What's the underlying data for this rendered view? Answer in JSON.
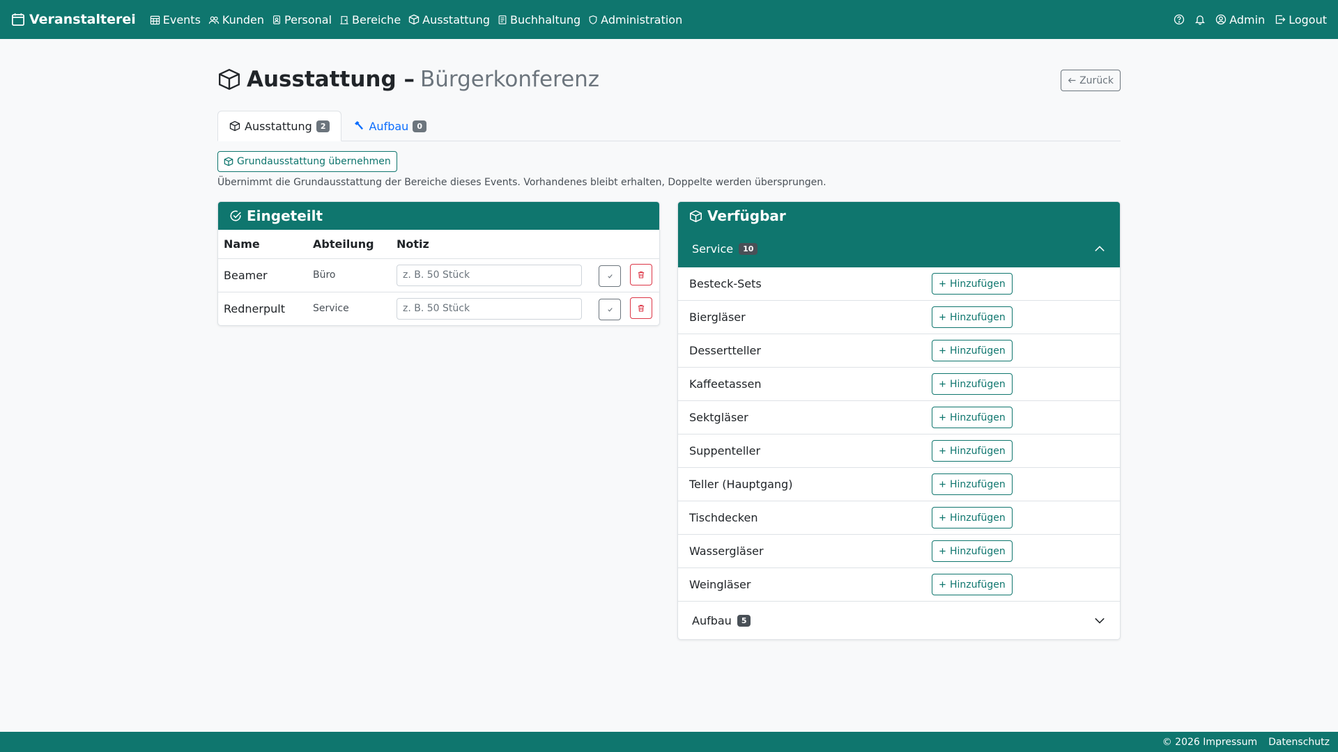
{
  "colors": {
    "brand": "#0f766e",
    "danger": "#dc3545",
    "link": "#0d6efd",
    "muted": "#6c757d"
  },
  "navbar": {
    "brand": "Veranstalterei",
    "items": [
      {
        "label": "Events",
        "icon": "calendar-grid-icon"
      },
      {
        "label": "Kunden",
        "icon": "people-icon"
      },
      {
        "label": "Personal",
        "icon": "person-badge-icon"
      },
      {
        "label": "Bereiche",
        "icon": "door-icon"
      },
      {
        "label": "Ausstattung",
        "icon": "box-icon"
      },
      {
        "label": "Buchhaltung",
        "icon": "ledger-icon"
      },
      {
        "label": "Administration",
        "icon": "shield-icon"
      }
    ],
    "user": "Admin",
    "logout": "Logout"
  },
  "page": {
    "title": "Ausstattung –",
    "subtitle": "Bürgerkonferenz",
    "back_label": "Zurück"
  },
  "tabs": [
    {
      "label": "Ausstattung",
      "count": "2",
      "active": true
    },
    {
      "label": "Aufbau",
      "count": "0",
      "active": false
    }
  ],
  "grund_button": "Grundausstattung übernehmen",
  "hint": "Übernimmt die Grundausstattung der Bereiche dieses Events. Vorhandenes bleibt erhalten, Doppelte werden übersprungen.",
  "assigned": {
    "title": "Eingeteilt",
    "columns": [
      "Name",
      "Abteilung",
      "Notiz"
    ],
    "rows": [
      {
        "name": "Beamer",
        "dept": "Büro",
        "note_placeholder": "z. B. 50 Stück"
      },
      {
        "name": "Rednerpult",
        "dept": "Service",
        "note_placeholder": "z. B. 50 Stück"
      }
    ]
  },
  "available": {
    "title": "Verfügbar",
    "groups": [
      {
        "name": "Service",
        "count": "10",
        "open": true,
        "items": [
          "Besteck-Sets",
          "Biergläser",
          "Dessertteller",
          "Kaffeetassen",
          "Sektgläser",
          "Suppenteller",
          "Teller (Hauptgang)",
          "Tischdecken",
          "Wassergläser",
          "Weingläser"
        ]
      },
      {
        "name": "Aufbau",
        "count": "5",
        "open": false,
        "items": []
      }
    ],
    "add_label": "Hinzufügen"
  },
  "footer": {
    "impressum": "© 2026 Impressum",
    "datenschutz": "Datenschutz"
  }
}
